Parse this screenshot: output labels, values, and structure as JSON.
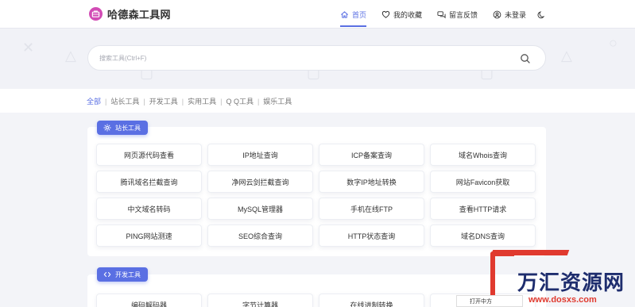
{
  "header": {
    "site_name": "哈德森工具网",
    "nav": [
      {
        "label": "首页",
        "icon": "home-icon",
        "active": true
      },
      {
        "label": "我的收藏",
        "icon": "heart-icon",
        "active": false
      },
      {
        "label": "留言反馈",
        "icon": "chat-icon",
        "active": false
      },
      {
        "label": "未登录",
        "icon": "user-icon",
        "active": false
      }
    ],
    "theme_icon": "moon-icon"
  },
  "search": {
    "placeholder": "搜索工具(Ctrl+F)",
    "value": ""
  },
  "categories": [
    {
      "label": "全部",
      "active": true
    },
    {
      "label": "站长工具",
      "active": false
    },
    {
      "label": "开发工具",
      "active": false
    },
    {
      "label": "实用工具",
      "active": false
    },
    {
      "label": "Q Q工具",
      "active": false
    },
    {
      "label": "娱乐工具",
      "active": false
    }
  ],
  "sections": [
    {
      "title": "站长工具",
      "icon": "gear-icon",
      "tools": [
        "网页源代码查看",
        "IP地址查询",
        "ICP备案查询",
        "域名Whois查询",
        "腾讯域名拦截查询",
        "净网云剑拦截查询",
        "数字IP地址转换",
        "网站Favicon获取",
        "中文域名转码",
        "MySQL管理器",
        "手机在线FTP",
        "查看HTTP请求",
        "PING网站测速",
        "SEO综合查询",
        "HTTP状态查询",
        "域名DNS查询"
      ]
    },
    {
      "title": "开发工具",
      "icon": "code-icon",
      "tools": [
        "编码解码器",
        "字节计算器",
        "在线进制转换",
        ""
      ]
    }
  ],
  "watermark": {
    "title": "万汇资源网",
    "url": "www.dosxs.com",
    "hint": "打开中方"
  },
  "colors": {
    "accent": "#5a6fe3",
    "brand": "#d24cb5",
    "watermark_red": "#e03a2f",
    "watermark_blue": "#1e2d6e"
  }
}
